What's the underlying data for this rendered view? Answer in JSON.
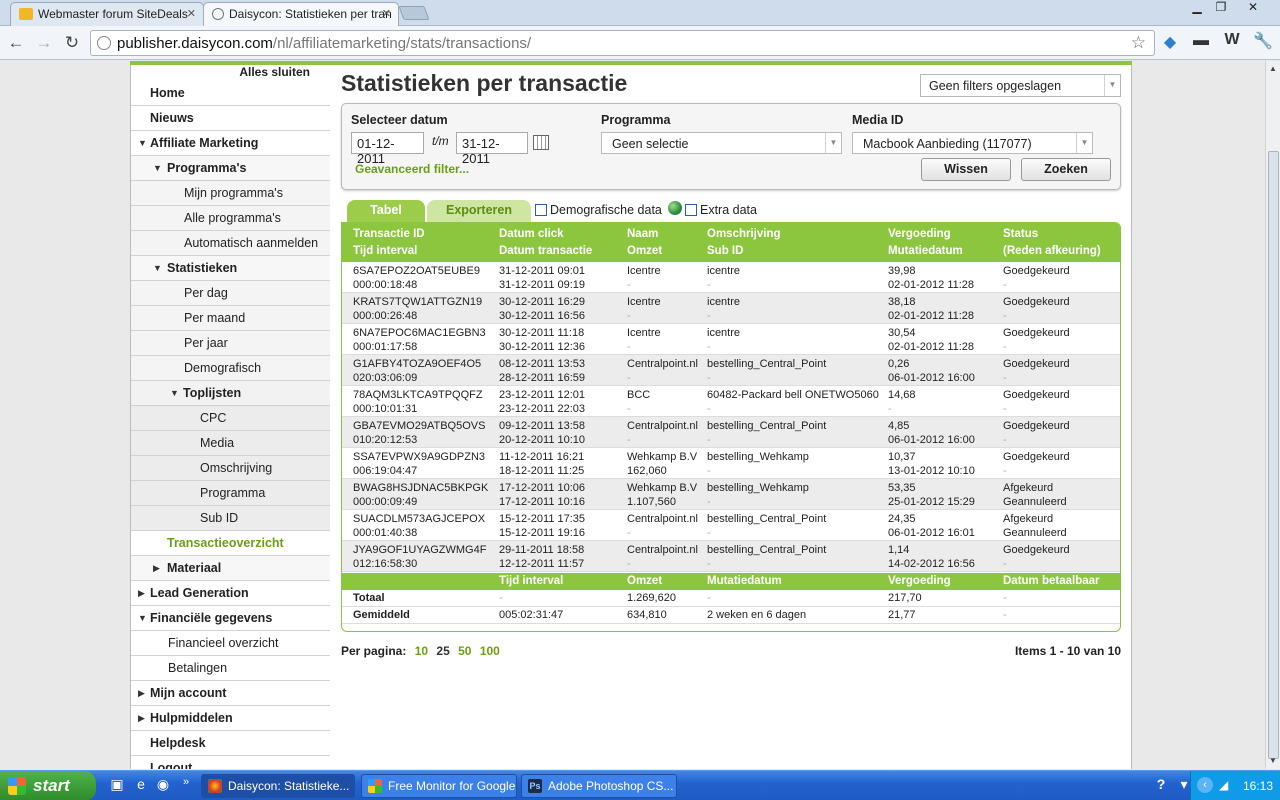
{
  "browser": {
    "tabs": [
      {
        "title": "Webmaster forum SiteDeals"
      },
      {
        "title": "Daisycon: Statistieken per tran"
      }
    ],
    "url_host": "publisher.daisycon.com",
    "url_path": "/nl/affiliatemarketing/stats/transactions/"
  },
  "sidebar": {
    "close_all": "Alles sluiten",
    "items": [
      {
        "label": "Home"
      },
      {
        "label": "Nieuws"
      },
      {
        "label": "Affiliate Marketing"
      },
      {
        "label": "Programma's"
      },
      {
        "label": "Mijn programma's"
      },
      {
        "label": "Alle programma's"
      },
      {
        "label": "Automatisch aanmelden"
      },
      {
        "label": "Statistieken"
      },
      {
        "label": "Per dag"
      },
      {
        "label": "Per maand"
      },
      {
        "label": "Per jaar"
      },
      {
        "label": "Demografisch"
      },
      {
        "label": "Toplijsten"
      },
      {
        "label": "CPC"
      },
      {
        "label": "Media"
      },
      {
        "label": "Omschrijving"
      },
      {
        "label": "Programma"
      },
      {
        "label": "Sub ID"
      },
      {
        "label": "Transactieoverzicht"
      },
      {
        "label": "Materiaal"
      },
      {
        "label": "Lead Generation"
      },
      {
        "label": "Financiële gegevens"
      },
      {
        "label": "Financieel overzicht"
      },
      {
        "label": "Betalingen"
      },
      {
        "label": "Mijn account"
      },
      {
        "label": "Hulpmiddelen"
      },
      {
        "label": "Helpdesk"
      },
      {
        "label": "Logout"
      }
    ]
  },
  "main": {
    "title": "Statistieken per transactie",
    "saved_filters": "Geen filters opgeslagen",
    "filter": {
      "date_label": "Selecteer datum",
      "date_from": "01-12-2011",
      "date_sep": "t/m",
      "date_to": "31-12-2011",
      "program_label": "Programma",
      "program_value": "Geen selectie",
      "media_label": "Media ID",
      "media_value": "Macbook Aanbieding (117077)",
      "advanced": "Geavanceerd filter...",
      "clear": "Wissen",
      "search": "Zoeken"
    },
    "tabs": [
      "Tabel",
      "Exporteren"
    ],
    "checkboxes": [
      "Demografische data",
      "Extra data"
    ],
    "table": {
      "headers": [
        [
          "Transactie ID",
          "Tijd interval"
        ],
        [
          "Datum click",
          "Datum transactie"
        ],
        [
          "Naam",
          "Omzet"
        ],
        [
          "Omschrijving",
          "Sub ID"
        ],
        [
          "Vergoeding",
          "Mutatiedatum"
        ],
        [
          "Status",
          "(Reden afkeuring)"
        ]
      ],
      "rows": [
        [
          [
            "6SA7EPOZ2OAT5EUBE9",
            "000:00:18:48"
          ],
          [
            "31-12-2011 09:01",
            "31-12-2011 09:19"
          ],
          [
            "Icentre",
            "-"
          ],
          [
            "icentre",
            "-"
          ],
          [
            "39,98",
            "02-01-2012 11:28"
          ],
          [
            "Goedgekeurd",
            "-"
          ]
        ],
        [
          [
            "KRATS7TQW1ATTGZN19",
            "000:00:26:48"
          ],
          [
            "30-12-2011 16:29",
            "30-12-2011 16:56"
          ],
          [
            "Icentre",
            "-"
          ],
          [
            "icentre",
            "-"
          ],
          [
            "38,18",
            "02-01-2012 11:28"
          ],
          [
            "Goedgekeurd",
            "-"
          ]
        ],
        [
          [
            "6NA7EPOC6MAC1EGBN3",
            "000:01:17:58"
          ],
          [
            "30-12-2011 11:18",
            "30-12-2011 12:36"
          ],
          [
            "Icentre",
            "-"
          ],
          [
            "icentre",
            "-"
          ],
          [
            "30,54",
            "02-01-2012 11:28"
          ],
          [
            "Goedgekeurd",
            "-"
          ]
        ],
        [
          [
            "G1AFBY4TOZA9OEF4O5",
            "020:03:06:09"
          ],
          [
            "08-12-2011 13:53",
            "28-12-2011 16:59"
          ],
          [
            "Centralpoint.nl",
            "-"
          ],
          [
            "bestelling_Central_Point",
            "-"
          ],
          [
            "0,26",
            "06-01-2012 16:00"
          ],
          [
            "Goedgekeurd",
            "-"
          ]
        ],
        [
          [
            "78AQM3LKTCA9TPQQFZ",
            "000:10:01:31"
          ],
          [
            "23-12-2011 12:01",
            "23-12-2011 22:03"
          ],
          [
            "BCC",
            "-"
          ],
          [
            "60482-Packard bell ONETWO5060",
            "-"
          ],
          [
            "14,68",
            "-"
          ],
          [
            "Goedgekeurd",
            "-"
          ]
        ],
        [
          [
            "GBA7EVMO29ATBQ5OVS",
            "010:20:12:53"
          ],
          [
            "09-12-2011 13:58",
            "20-12-2011 10:10"
          ],
          [
            "Centralpoint.nl",
            "-"
          ],
          [
            "bestelling_Central_Point",
            "-"
          ],
          [
            "4,85",
            "06-01-2012 16:00"
          ],
          [
            "Goedgekeurd",
            "-"
          ]
        ],
        [
          [
            "SSA7EVPWX9A9GDPZN3",
            "006:19:04:47"
          ],
          [
            "11-12-2011 16:21",
            "18-12-2011 11:25"
          ],
          [
            "Wehkamp B.V",
            "162,060"
          ],
          [
            "bestelling_Wehkamp",
            "-"
          ],
          [
            "10,37",
            "13-01-2012 10:10"
          ],
          [
            "Goedgekeurd",
            "-"
          ]
        ],
        [
          [
            "BWAG8HSJDNAC5BKPGK",
            "000:00:09:49"
          ],
          [
            "17-12-2011 10:06",
            "17-12-2011 10:16"
          ],
          [
            "Wehkamp B.V",
            "1.107,560"
          ],
          [
            "bestelling_Wehkamp",
            "-"
          ],
          [
            "53,35",
            "25-01-2012 15:29"
          ],
          [
            "Afgekeurd",
            "Geannuleerd"
          ]
        ],
        [
          [
            "SUACDLM573AGJCEPOX",
            "000:01:40:38"
          ],
          [
            "15-12-2011 17:35",
            "15-12-2011 19:16"
          ],
          [
            "Centralpoint.nl",
            "-"
          ],
          [
            "bestelling_Central_Point",
            "-"
          ],
          [
            "24,35",
            "06-01-2012 16:01"
          ],
          [
            "Afgekeurd",
            "Geannuleerd"
          ]
        ],
        [
          [
            "JYA9GOF1UYAGZWMG4F",
            "012:16:58:30"
          ],
          [
            "29-11-2011 18:58",
            "12-12-2011 11:57"
          ],
          [
            "Centralpoint.nl",
            "-"
          ],
          [
            "bestelling_Central_Point",
            "-"
          ],
          [
            "1,14",
            "14-02-2012 16:56"
          ],
          [
            "Goedgekeurd",
            "-"
          ]
        ]
      ],
      "summary_headers": [
        "Tijd interval",
        "Omzet",
        "Mutatiedatum",
        "Vergoeding",
        "Datum betaalbaar"
      ],
      "summary_rows": [
        {
          "label": "Totaal",
          "values": [
            "-",
            "1.269,620",
            "-",
            "217,70",
            "-"
          ]
        },
        {
          "label": "Gemiddeld",
          "values": [
            "005:02:31:47",
            "634,810",
            "2 weken en 6 dagen",
            "21,77",
            "-"
          ]
        }
      ]
    },
    "per_page_label": "Per pagina:",
    "per_page_options": [
      "10",
      "25",
      "50",
      "100"
    ],
    "items_text": "Items 1 - 10 van 10"
  },
  "taskbar": {
    "start": "start",
    "tasks": [
      "Daisycon: Statistieke...",
      "Free Monitor for Google",
      "Adobe Photoshop CS..."
    ],
    "clock": "16:13"
  },
  "colors": {
    "accent_green": "#8cc63f",
    "link_green": "#6c9e14"
  }
}
